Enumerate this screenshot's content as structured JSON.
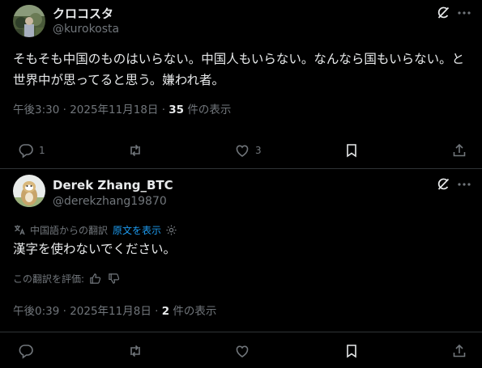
{
  "posts": [
    {
      "display_name": "クロコスタ",
      "handle": "@kurokosta",
      "text": "そもそも中国のものはいらない。中国人もいらない。なんなら国もいらない。と世界中が思ってると思う。嫌われ者。",
      "timestamp": "午後3:30 · 2025年11月18日 · ",
      "views_count": "35",
      "views_label": " 件の表示",
      "replies": "1",
      "reposts": "",
      "likes": "3"
    },
    {
      "display_name": "Derek Zhang_BTC",
      "handle": "@derekzhang19870",
      "translation_note": "中国語からの翻訳",
      "show_original": "原文を表示",
      "text": "漢字を使わないでください。",
      "rate_translation": "この翻訳を評価:",
      "timestamp": "午後0:39 · 2025年11月8日 · ",
      "views_count": "2",
      "views_label": " 件の表示"
    }
  ],
  "icons": {
    "grok": "grok-icon",
    "more": "more-icon",
    "reply": "reply-icon",
    "repost": "repost-icon",
    "like": "like-icon",
    "bookmark": "bookmark-icon",
    "share": "share-icon",
    "translate": "translate-icon",
    "settings": "gear-icon",
    "thumbs_up": "thumbs-up-icon",
    "thumbs_down": "thumbs-down-icon"
  },
  "colors": {
    "background": "#000000",
    "text": "#e7e9ea",
    "secondary": "#71767b",
    "link": "#1d9bf0",
    "divider": "#2f3336"
  }
}
